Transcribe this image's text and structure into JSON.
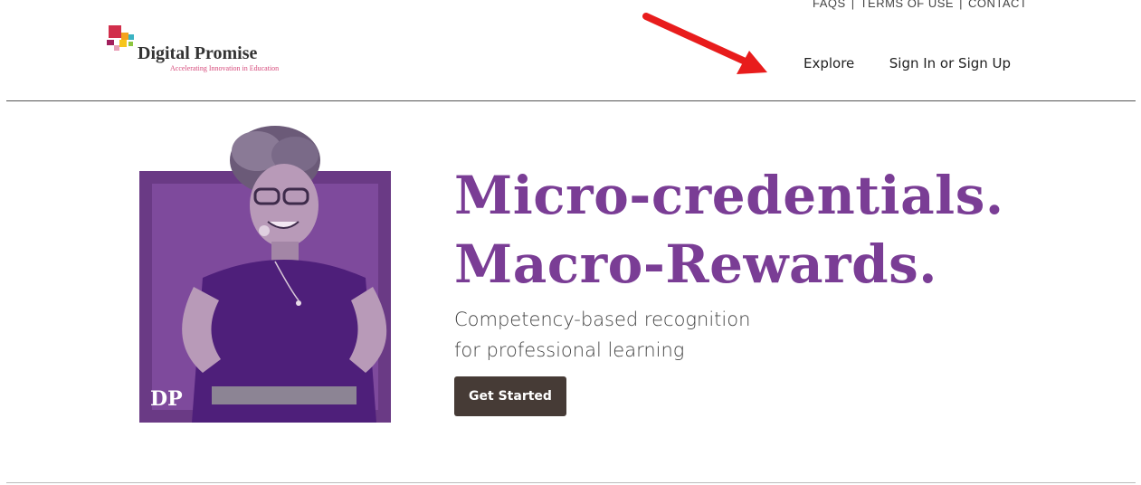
{
  "brand": {
    "name": "Digital Promise",
    "tagline": "Accelerating Innovation in Education",
    "colors": {
      "accent_purple": "#7a3d95",
      "button_dark": "#463b36",
      "logo_pink": "#d64a7b"
    }
  },
  "utility_nav": {
    "faqs": "FAQS",
    "terms": "TERMS OF USE",
    "contact": "CONTACT",
    "separator": "|"
  },
  "main_nav": {
    "explore": "Explore",
    "sign_in": "Sign In or Sign Up"
  },
  "hero": {
    "headline_line1": "Micro-credentials.",
    "headline_line2": "Macro-Rewards.",
    "subhead_line1": "Competency-based recognition",
    "subhead_line2": "for professional learning",
    "cta_label": "Get Started",
    "portrait_badge": "DP"
  },
  "annotation": {
    "icon": "red-arrow-icon",
    "color": "#e81c1c"
  }
}
